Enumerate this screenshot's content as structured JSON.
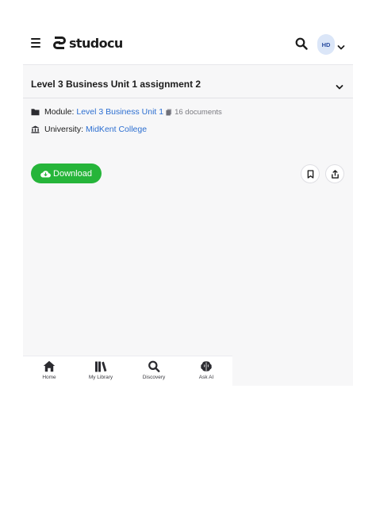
{
  "header": {
    "logo_text": "studocu",
    "avatar_initials": "HD"
  },
  "document": {
    "title": "Level 3 Business Unit 1 assignment 2",
    "module_label": "Module:",
    "module_name": "Level 3 Business Unit 1",
    "module_doc_count": "16 documents",
    "university_label": "University:",
    "university_name": "MidKent College",
    "download_label": "Download"
  },
  "bottom_nav": {
    "items": [
      {
        "label": "Home",
        "icon": "home-icon"
      },
      {
        "label": "My Library",
        "icon": "library-icon"
      },
      {
        "label": "Discovery",
        "icon": "search-icon"
      },
      {
        "label": "Ask AI",
        "icon": "brain-icon"
      }
    ]
  },
  "colors": {
    "accent_green": "#26b53a",
    "link_blue": "#2d6fd1",
    "avatar_bg": "#dbe6f8"
  }
}
